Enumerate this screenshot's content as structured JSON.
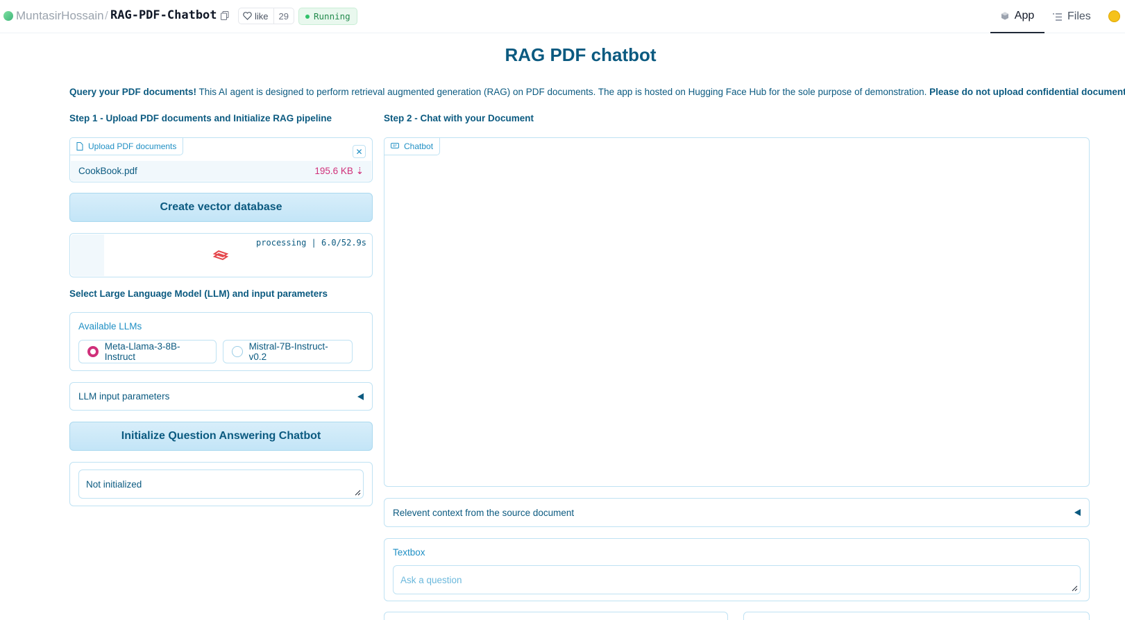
{
  "header": {
    "owner": "MuntasirHossain",
    "separator": "/",
    "repo": "RAG-PDF-Chatbot",
    "like_label": "like",
    "like_count": "29",
    "status": "Running",
    "tabs": [
      {
        "label": "App",
        "active": true,
        "icon": "app-icon"
      },
      {
        "label": "Files",
        "active": false,
        "icon": "files-icon"
      }
    ]
  },
  "main": {
    "title": "RAG PDF chatbot",
    "intro_bold": "Query your PDF documents!",
    "intro_text": " This AI agent is designed to perform retrieval augmented generation (RAG) on PDF documents. The app is hosted on Hugging Face Hub for the sole purpose of demonstration. ",
    "intro_warning": "Please do not upload confidential documents."
  },
  "step1": {
    "label": "Step 1 - Upload PDF documents and Initialize RAG pipeline",
    "upload_chip": "Upload PDF documents",
    "file_name": "CookBook.pdf",
    "file_size": "195.6 KB",
    "create_db_button": "Create vector database",
    "progress_text": "processing | 6.0/52.9s",
    "llm_section_label": "Select Large Language Model (LLM) and input parameters",
    "llm_group_label": "Available LLMs",
    "llm_options": [
      {
        "label": "Meta-Llama-3-8B-Instruct",
        "selected": true
      },
      {
        "label": "Mistral-7B-Instruct-v0.2",
        "selected": false
      }
    ],
    "llm_params_accordion": "LLM input parameters",
    "init_button": "Initialize Question Answering Chatbot",
    "status_value": "Not initialized"
  },
  "step2": {
    "label": "Step 2 - Chat with your Document",
    "chatbot_chip": "Chatbot",
    "context_accordion": "Relevent context from the source document",
    "textbox_label": "Textbox",
    "textbox_placeholder": "Ask a question"
  },
  "colors": {
    "accent": "#0b5a80",
    "border": "#bfe2f3",
    "pink": "#d0307a",
    "button_bg": "#c3e5f7"
  }
}
